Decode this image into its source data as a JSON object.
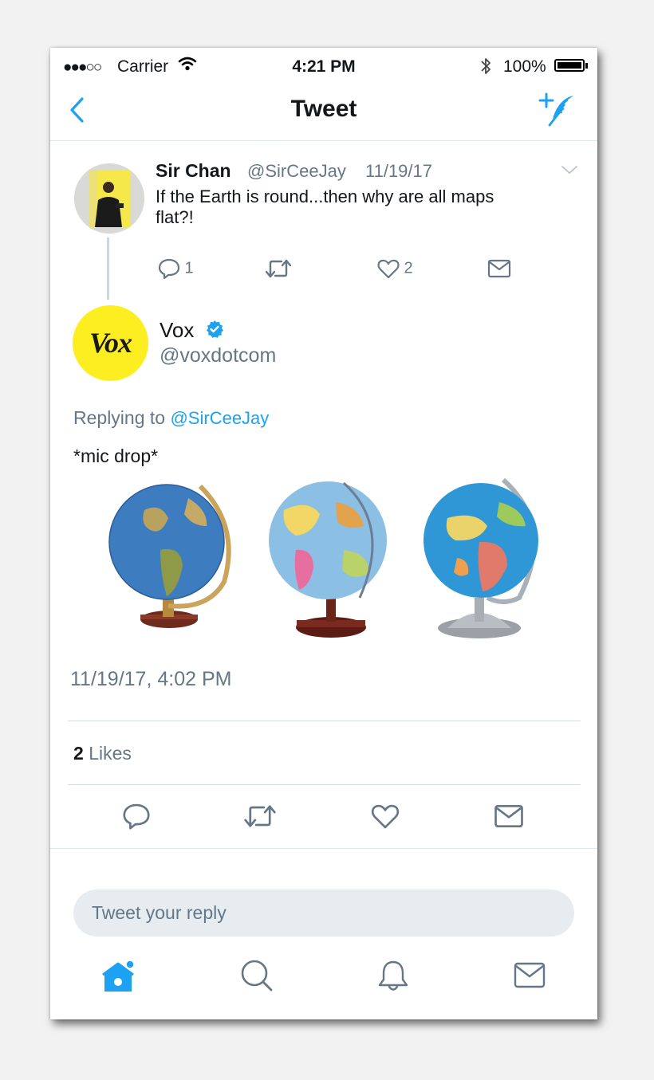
{
  "status_bar": {
    "signal": "●●●○○",
    "carrier": "Carrier",
    "time": "4:21 PM",
    "battery": "100%"
  },
  "nav": {
    "title": "Tweet",
    "back_icon": "chevron-left-icon",
    "compose_icon": "compose-tweet-icon"
  },
  "parent_tweet": {
    "name": "Sir Chan",
    "handle": "@SirCeeJay",
    "date": "11/19/17",
    "text": "If the Earth is round...then why are all maps flat?!",
    "replies": "1",
    "likes": "2"
  },
  "main_tweet": {
    "name": "Vox",
    "avatar_text": "Vox",
    "handle": "@voxdotcom",
    "replying_prefix": "Replying to",
    "replying_to": "@SirCeeJay",
    "text": "*mic drop*",
    "timestamp": "11/19/17, 4:02 PM",
    "likes_count": "2",
    "likes_label": "Likes"
  },
  "reply": {
    "placeholder": "Tweet your reply"
  },
  "tab_bar": {
    "items": [
      "home-icon",
      "search-icon",
      "notifications-bell-icon",
      "messages-icon"
    ]
  },
  "colors": {
    "accent": "#1da1f2",
    "secondary_text": "#657786",
    "icon_gray": "#657786",
    "vox_yellow": "#fcee21"
  }
}
